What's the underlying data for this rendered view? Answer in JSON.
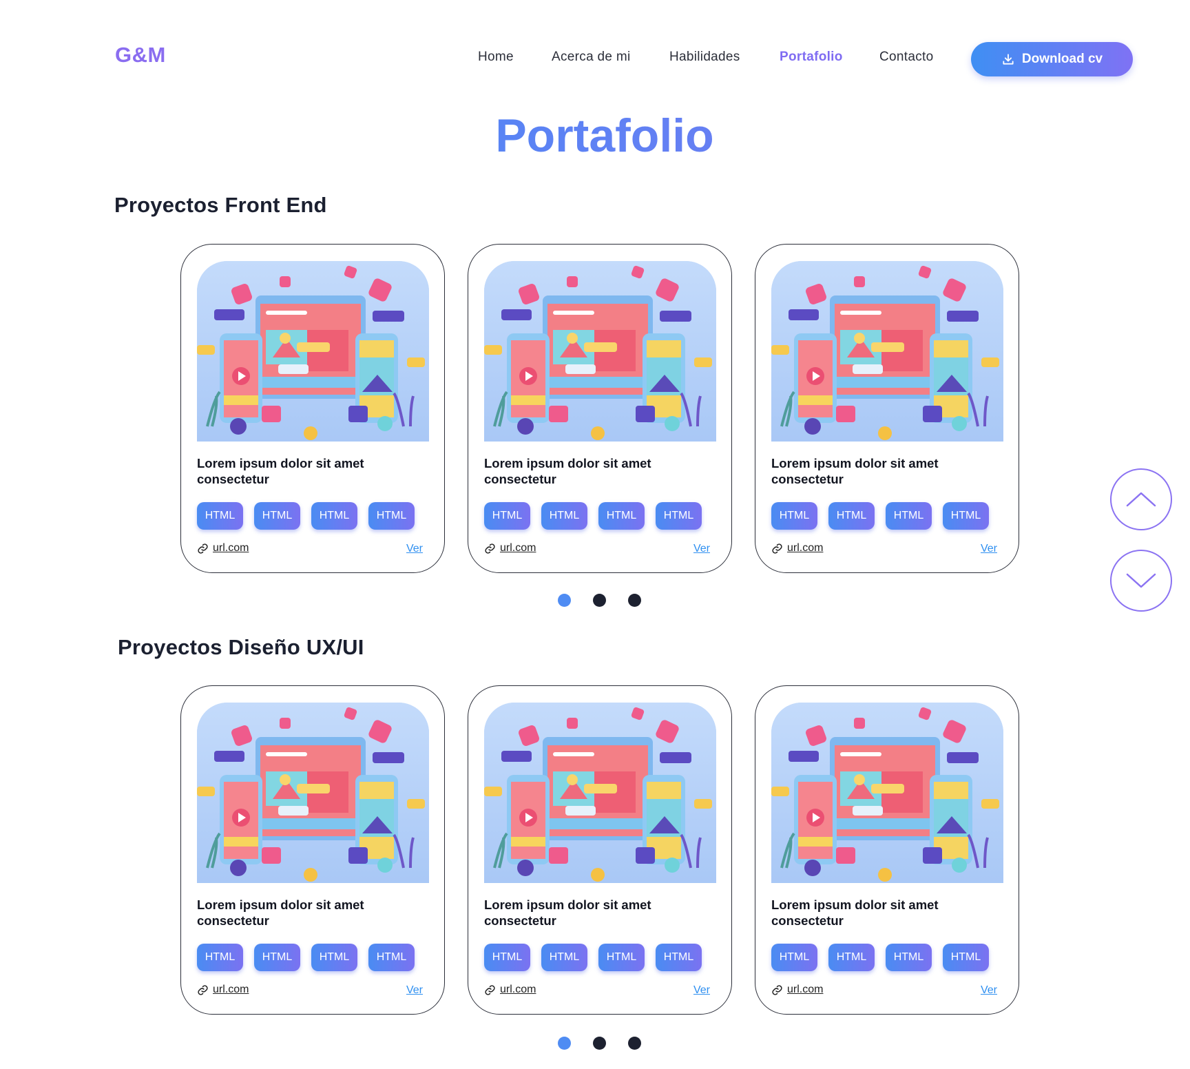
{
  "header": {
    "logo": "G&M",
    "nav": [
      {
        "label": "Home",
        "active": false
      },
      {
        "label": "Acerca de mi",
        "active": false
      },
      {
        "label": "Habilidades",
        "active": false
      },
      {
        "label": "Portafolio",
        "active": true
      },
      {
        "label": "Contacto",
        "active": false
      }
    ],
    "download_label": "Download cv"
  },
  "page_title": "Portafolio",
  "sections": [
    {
      "title": "Proyectos Front End",
      "cards": [
        {
          "title": "Lorem ipsum dolor sit amet consectetur",
          "tags": [
            "HTML",
            "HTML",
            "HTML",
            "HTML"
          ],
          "url": "url.com",
          "link_label": "Ver"
        },
        {
          "title": "Lorem ipsum dolor sit amet consectetur",
          "tags": [
            "HTML",
            "HTML",
            "HTML",
            "HTML"
          ],
          "url": "url.com",
          "link_label": "Ver"
        },
        {
          "title": "Lorem ipsum dolor sit amet consectetur",
          "tags": [
            "HTML",
            "HTML",
            "HTML",
            "HTML"
          ],
          "url": "url.com",
          "link_label": "Ver"
        }
      ],
      "pagination": {
        "count": 3,
        "active": 0
      }
    },
    {
      "title": "Proyectos Diseño UX/UI",
      "cards": [
        {
          "title": "Lorem ipsum dolor sit amet consectetur",
          "tags": [
            "HTML",
            "HTML",
            "HTML",
            "HTML"
          ],
          "url": "url.com",
          "link_label": "Ver"
        },
        {
          "title": "Lorem ipsum dolor sit amet consectetur",
          "tags": [
            "HTML",
            "HTML",
            "HTML",
            "HTML"
          ],
          "url": "url.com",
          "link_label": "Ver"
        },
        {
          "title": "Lorem ipsum dolor sit amet consectetur",
          "tags": [
            "HTML",
            "HTML",
            "HTML",
            "HTML"
          ],
          "url": "url.com",
          "link_label": "Ver"
        }
      ],
      "pagination": {
        "count": 3,
        "active": 0
      }
    }
  ],
  "scroll_controls": {
    "up_icon": "chevron-up-icon",
    "down_icon": "chevron-down-icon"
  },
  "colors": {
    "accent_blue": "#3f8ff3",
    "accent_purple": "#7f72f4",
    "dot_inactive": "#1d2130",
    "link": "#2e8ff0"
  }
}
